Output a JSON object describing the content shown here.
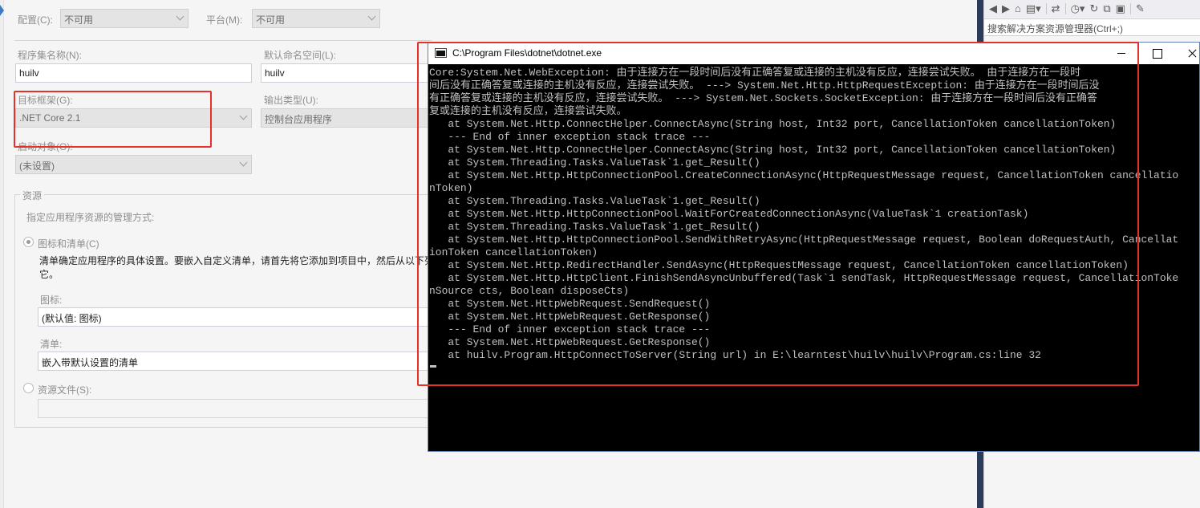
{
  "props": {
    "config_label": "配置(C):",
    "config_value": "不可用",
    "platform_label": "平台(M):",
    "platform_value": "不可用",
    "assembly_name_label": "程序集名称(N):",
    "assembly_name_value": "huilv",
    "default_namespace_label": "默认命名空间(L):",
    "default_namespace_value": "huilv",
    "target_framework_label": "目标框架(G):",
    "target_framework_value": ".NET Core 2.1",
    "output_type_label": "输出类型(U):",
    "output_type_value": "控制台应用程序",
    "startup_object_label": "启动对象(O):",
    "startup_object_value": "(未设置)",
    "resources_group_title": "资源",
    "resources_desc": "指定应用程序资源的管理方式:",
    "icon_manifest_radio_label": "图标和清单(C)",
    "manifest_desc_line1": "清单确定应用程序的具体设置。要嵌入自定义清单，请首先将它添加到项目中，然后从以下列",
    "manifest_desc_line2": "它。",
    "icon_label": "图标:",
    "icon_value": "(默认值: 图标)",
    "manifest_label": "清单:",
    "manifest_value": "嵌入带默认设置的清单",
    "resource_file_radio_label": "资源文件(S):",
    "resource_file_value": ""
  },
  "solution_explorer": {
    "search_placeholder": "搜索解决方案资源管理器(Ctrl+;)",
    "toolbar_icons": [
      "back-icon",
      "forward-icon",
      "home-icon",
      "switch-views-icon",
      "sync-icon",
      "pending-changes-icon",
      "refresh-icon",
      "collapse-all-icon",
      "show-all-files-icon",
      "properties-icon"
    ]
  },
  "console": {
    "title": "C:\\Program Files\\dotnet\\dotnet.exe",
    "lines": [
      "Core:System.Net.WebException: 由于连接方在一段时间后没有正确答复或连接的主机没有反应，连接尝试失败。 由于连接方在一段时",
      "间后没有正确答复或连接的主机没有反应，连接尝试失败。 ---> System.Net.Http.HttpRequestException: 由于连接方在一段时间后没",
      "有正确答复或连接的主机没有反应，连接尝试失败。 ---> System.Net.Sockets.SocketException: 由于连接方在一段时间后没有正确答",
      "复或连接的主机没有反应，连接尝试失败。",
      "   at System.Net.Http.ConnectHelper.ConnectAsync(String host, Int32 port, CancellationToken cancellationToken)",
      "   --- End of inner exception stack trace ---",
      "   at System.Net.Http.ConnectHelper.ConnectAsync(String host, Int32 port, CancellationToken cancellationToken)",
      "   at System.Threading.Tasks.ValueTask`1.get_Result()",
      "   at System.Net.Http.HttpConnectionPool.CreateConnectionAsync(HttpRequestMessage request, CancellationToken cancellatio",
      "nToken)",
      "   at System.Threading.Tasks.ValueTask`1.get_Result()",
      "   at System.Net.Http.HttpConnectionPool.WaitForCreatedConnectionAsync(ValueTask`1 creationTask)",
      "   at System.Threading.Tasks.ValueTask`1.get_Result()",
      "   at System.Net.Http.HttpConnectionPool.SendWithRetryAsync(HttpRequestMessage request, Boolean doRequestAuth, Cancellat",
      "ionToken cancellationToken)",
      "   at System.Net.Http.RedirectHandler.SendAsync(HttpRequestMessage request, CancellationToken cancellationToken)",
      "   at System.Net.Http.HttpClient.FinishSendAsyncUnbuffered(Task`1 sendTask, HttpRequestMessage request, CancellationToke",
      "nSource cts, Boolean disposeCts)",
      "   at System.Net.HttpWebRequest.SendRequest()",
      "   at System.Net.HttpWebRequest.GetResponse()",
      "   --- End of inner exception stack trace ---",
      "   at System.Net.HttpWebRequest.GetResponse()",
      "   at huilv.Program.HttpConnectToServer(String url) in E:\\learntest\\huilv\\huilv\\Program.cs:line 32"
    ]
  },
  "colors": {
    "annotation_red": "#e6302b",
    "console_bg": "#000000",
    "console_text": "#c0c0c0"
  }
}
